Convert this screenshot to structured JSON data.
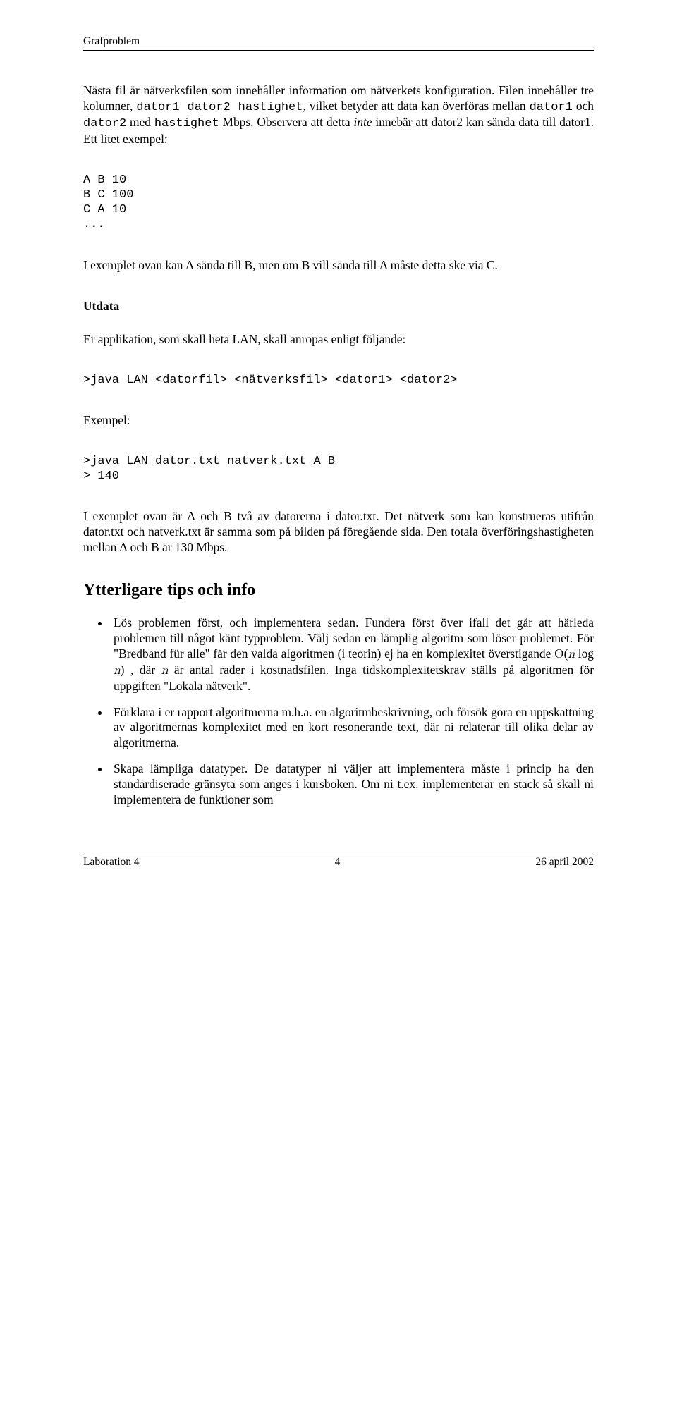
{
  "header": {
    "title": "Grafproblem"
  },
  "p1_a": "Nästa fil är nätverksfilen som innehåller information om nätverkets konfiguration. Filen innehåller tre kolumner, ",
  "p1_tt1": "dator1 dator2 hastighet",
  "p1_b": ", vilket betyder att data kan överföras mellan ",
  "p1_tt2": "dator1",
  "p1_c": " och ",
  "p1_tt3": "dator2",
  "p1_d": " med ",
  "p1_tt4": "hastighet",
  "p1_e": " Mbps. Observera att detta ",
  "p1_it": "inte",
  "p1_f": " innebär att dator2 kan sända data till dator1. Ett litet exempel:",
  "code1": "A B 10\nB C 100\nC A 10\n...",
  "p2": "I exemplet ovan kan A sända till B, men om B vill sända till A måste detta ske via C.",
  "sub_utdata": "Utdata",
  "p3": "Er applikation, som skall heta LAN, skall anropas enligt följande:",
  "code2": ">java LAN <datorfil> <nätverksfil> <dator1> <dator2>",
  "p4": "Exempel:",
  "code3": ">java LAN dator.txt natverk.txt A B\n> 140",
  "p5": "I exemplet ovan är A och B två av datorerna i dator.txt. Det nätverk som kan konstrueras utifrån dator.txt och natverk.txt är samma som på bilden på föregående sida. Den totala överföringshastigheten mellan A och B är 130 Mbps.",
  "section_tips": "Ytterligare tips och info",
  "tip1_a": "Lös problemen först, och implementera sedan. Fundera först över ifall det går att härleda problemen till något känt typproblem. Välj sedan en lämplig algoritm som löser problemet. För \"Bredband für alle\" får den valda algoritmen (i teorin) ej ha en komplexitet överstigande ",
  "tip1_math_O": "O",
  "tip1_math_open": "(",
  "tip1_math_n": "n",
  "tip1_math_log": " log ",
  "tip1_math_n2": "n",
  "tip1_math_close": ")",
  "tip1_b": " , där ",
  "tip1_n": "n",
  "tip1_c": " är antal rader i kostnadsfilen. Inga tidskomplexitetskrav ställs på algoritmen för uppgiften \"Lokala nätverk\".",
  "tip2": "Förklara i er rapport algoritmerna m.h.a. en algoritmbeskrivning, och försök göra en uppskattning av algoritmernas komplexitet med en kort resonerande text, där ni relaterar till olika delar av algoritmerna.",
  "tip3": "Skapa lämpliga datatyper. De datatyper ni väljer att implementera måste i princip ha den standardiserade gränsyta som anges i kursboken. Om ni t.ex. implementerar en stack så skall ni implementera de funktioner som",
  "footer": {
    "left": "Laboration 4",
    "center": "4",
    "right": "26 april 2002"
  }
}
